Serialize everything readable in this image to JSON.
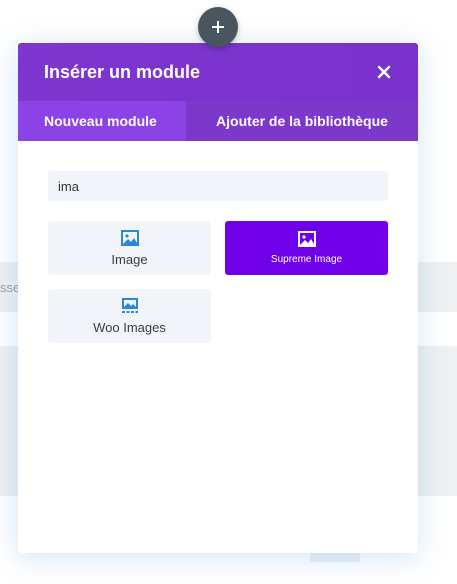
{
  "background": {
    "partial_text": "sse"
  },
  "colors": {
    "header": "#7d36cf",
    "tab_active": "#8b43e6",
    "tab_inactive": "#7b38cb",
    "module_highlight": "#7000e8",
    "icon_blue": "#2b87da",
    "add_button": "#4a5560"
  },
  "add_button": {
    "icon": "plus-icon"
  },
  "modal": {
    "title": "Insérer un module",
    "close_icon": "close-icon",
    "tabs": [
      {
        "label": "Nouveau module",
        "active": true
      },
      {
        "label": "Ajouter de la bibliothèque",
        "active": false
      }
    ],
    "search": {
      "value": "ima",
      "placeholder": ""
    },
    "modules": [
      {
        "label": "Image",
        "icon": "image-icon",
        "highlighted": false
      },
      {
        "label": "Supreme Image",
        "icon": "image-icon",
        "highlighted": true
      },
      {
        "label": "Woo Images",
        "icon": "gallery-icon",
        "highlighted": false
      }
    ]
  }
}
